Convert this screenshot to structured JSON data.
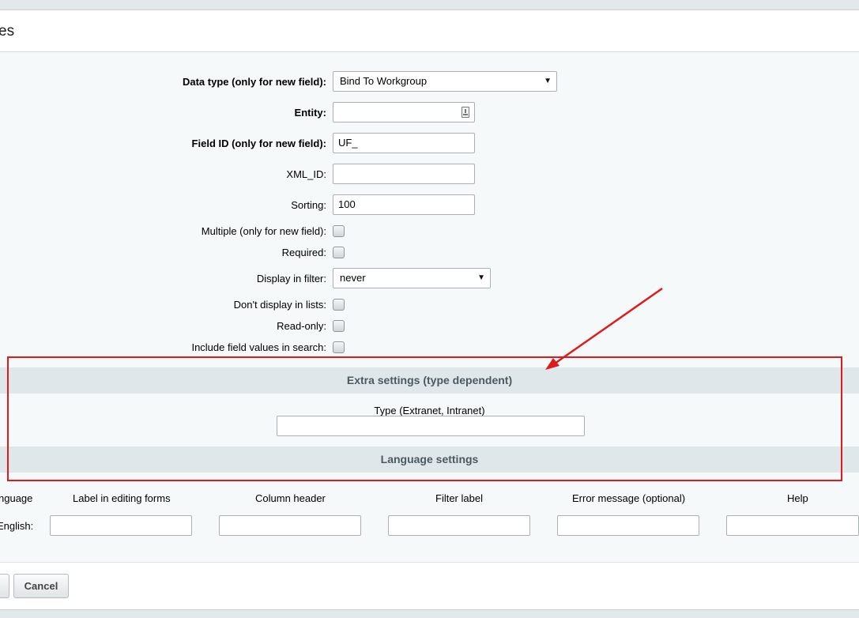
{
  "header": {
    "title": "es"
  },
  "form": {
    "data_type": {
      "label": "Data type (only for new field):",
      "value": "Bind To Workgroup"
    },
    "entity": {
      "label": "Entity:",
      "value": ""
    },
    "field_id": {
      "label": "Field ID (only for new field):",
      "value": "UF_"
    },
    "xml_id": {
      "label": "XML_ID:",
      "value": ""
    },
    "sorting": {
      "label": "Sorting:",
      "value": "100"
    },
    "multiple": {
      "label": "Multiple (only for new field):",
      "checked": false
    },
    "required": {
      "label": "Required:",
      "checked": false
    },
    "display_filter": {
      "label": "Display in filter:",
      "value": "never"
    },
    "dont_display_lists": {
      "label": "Don't display in lists:",
      "checked": false
    },
    "read_only": {
      "label": "Read-only:",
      "checked": false
    },
    "include_search": {
      "label": "Include field values in search:",
      "checked": false
    }
  },
  "extra": {
    "title": "Extra settings (type dependent)",
    "type_label": "Type (Extranet, Intranet)",
    "type_value": ""
  },
  "language": {
    "title": "Language settings",
    "columns": [
      "nguage",
      "Label in editing forms",
      "Column header",
      "Filter label",
      "Error message (optional)",
      "Help"
    ],
    "row_label": "English:"
  },
  "footer": {
    "cancel_label": "Cancel"
  },
  "colors": {
    "annotation_red": "#e01a1a",
    "section_bg": "#e0e7ea",
    "content_bg": "#f5f9f9"
  }
}
